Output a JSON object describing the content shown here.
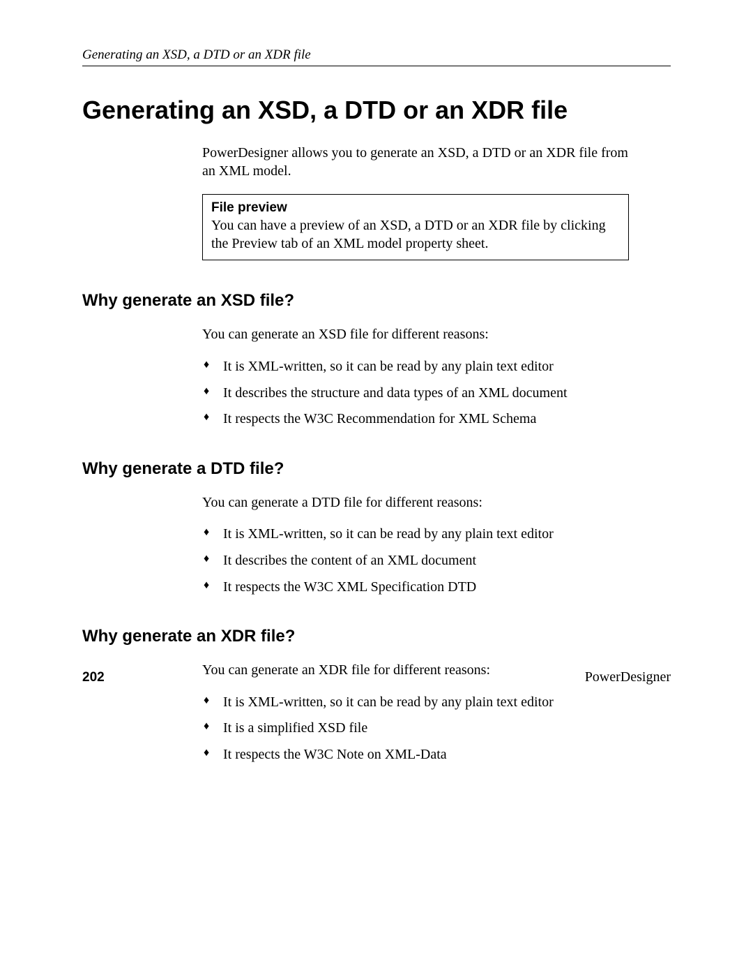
{
  "running_header": "Generating an XSD, a DTD or an XDR file",
  "title": "Generating an XSD, a DTD or an XDR file",
  "intro": "PowerDesigner allows you to generate an XSD, a DTD or an XDR file from an XML model.",
  "note": {
    "title": "File preview",
    "body": "You can have a preview of an XSD, a DTD or an XDR file by clicking the Preview tab of an XML model property sheet."
  },
  "sections": [
    {
      "heading": "Why generate an XSD file?",
      "lead": "You can generate an XSD file for different reasons:",
      "bullets": [
        "It is XML-written, so it can be read by any plain text editor",
        "It describes the structure and data types of an XML document",
        "It respects the W3C Recommendation for XML Schema"
      ]
    },
    {
      "heading": "Why generate a DTD file?",
      "lead": "You can generate a DTD file for different reasons:",
      "bullets": [
        "It is XML-written, so it can be read by any plain text editor",
        "It describes the content of an XML document",
        "It respects the W3C XML Specification DTD"
      ]
    },
    {
      "heading": "Why generate an XDR file?",
      "lead": "You can generate an XDR file for different reasons:",
      "bullets": [
        "It is XML-written, so it can be read by any plain text editor",
        "It is a simplified XSD file",
        "It respects the W3C Note on XML-Data"
      ]
    }
  ],
  "footer": {
    "page_number": "202",
    "product": "PowerDesigner"
  }
}
